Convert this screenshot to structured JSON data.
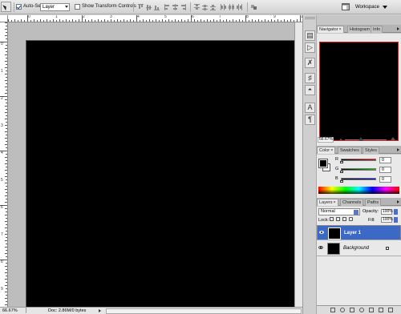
{
  "options_bar": {
    "auto_select_label": "Auto-Select:",
    "auto_select_checked": true,
    "auto_select_target": "Layer",
    "show_transform_label": "Show Transform Controls",
    "show_transform_checked": false,
    "workspace_label": "Workspace"
  },
  "ruler": {
    "h_labels": [
      "0",
      "1",
      "2",
      "3",
      "4",
      "5",
      "6",
      "7",
      "8",
      "9",
      "10"
    ],
    "v_labels": [
      "0",
      "1",
      "2",
      "3",
      "4",
      "5",
      "6",
      "7",
      "8",
      "9",
      "10"
    ]
  },
  "status": {
    "zoom": "66.67%",
    "doc_info": "Doc: 2.86M/0 bytes"
  },
  "navigator": {
    "tabs": [
      "Navigator",
      "Histogram",
      "Info"
    ],
    "tab_close": "×",
    "zoom": "66.67%",
    "frame_color": "#d61e1e"
  },
  "color_panel": {
    "tabs": [
      "Color",
      "Swatches",
      "Styles"
    ],
    "tab_close": "×",
    "rows": [
      {
        "label": "R",
        "value": "0",
        "color": "#cc0000"
      },
      {
        "label": "G",
        "value": "0",
        "color": "#00aa00"
      },
      {
        "label": "B",
        "value": "0",
        "color": "#0000cc"
      }
    ],
    "foreground": "#000000",
    "background": "#ffffff"
  },
  "layers_panel": {
    "tabs": [
      "Layers",
      "Channels",
      "Paths"
    ],
    "tab_close": "×",
    "blend_mode": "Normal",
    "opacity_label": "Opacity:",
    "opacity_value": "100%",
    "lock_label": "Lock:",
    "fill_label": "Fill:",
    "fill_value": "100%",
    "layers": [
      {
        "name": "Layer 1",
        "selected": true,
        "visible": true,
        "italic": false
      },
      {
        "name": "Background",
        "selected": false,
        "visible": true,
        "italic": true,
        "locked": true
      }
    ],
    "selection_color": "#3c68c6"
  }
}
